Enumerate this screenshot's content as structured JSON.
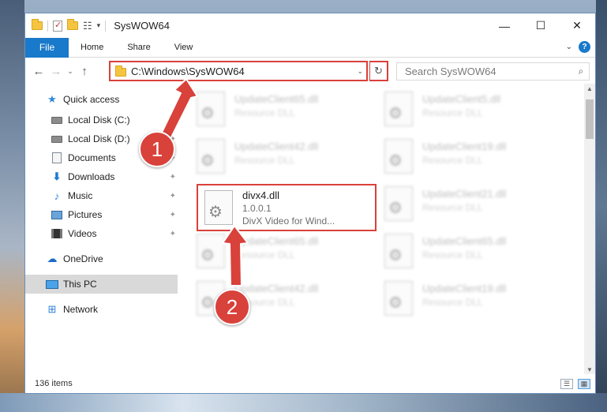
{
  "window": {
    "title": "SysWOW64",
    "controls": {
      "minimize": "—",
      "maximize": "☐",
      "close": "✕"
    }
  },
  "ribbon": {
    "file_label": "File",
    "tabs": [
      "Home",
      "Share",
      "View"
    ],
    "expand_glyph": "⌄",
    "help_glyph": "?"
  },
  "navbar": {
    "back_glyph": "←",
    "forward_glyph": "→",
    "recent_glyph": "⌄",
    "up_glyph": "↑",
    "address": "C:\\Windows\\SysWOW64",
    "address_caret": "⌄",
    "refresh_glyph": "↻",
    "search_placeholder": "Search SysWOW64",
    "search_glyph": "⌕"
  },
  "sidebar": {
    "items": [
      {
        "label": "Quick access",
        "icon": "star-icon",
        "pinned": false
      },
      {
        "label": "Local Disk (C:)",
        "icon": "drive-icon",
        "pinned": true
      },
      {
        "label": "Local Disk (D:)",
        "icon": "drive-icon",
        "pinned": true
      },
      {
        "label": "Documents",
        "icon": "documents-icon",
        "pinned": true
      },
      {
        "label": "Downloads",
        "icon": "download-icon",
        "pinned": true
      },
      {
        "label": "Music",
        "icon": "music-icon",
        "pinned": true
      },
      {
        "label": "Pictures",
        "icon": "pictures-icon",
        "pinned": true
      },
      {
        "label": "Videos",
        "icon": "videos-icon",
        "pinned": true
      },
      {
        "label": "OneDrive",
        "icon": "cloud-icon",
        "pinned": false
      },
      {
        "label": "This PC",
        "icon": "pc-icon",
        "pinned": false,
        "selected": true
      },
      {
        "label": "Network",
        "icon": "network-icon",
        "pinned": false
      }
    ],
    "pin_glyph": "📌"
  },
  "files": {
    "left_column": [
      {
        "name": "UpdateClient65.dll",
        "sub": "Resource DLL"
      },
      {
        "name": "UpdateClient42.dll",
        "sub": "Resource DLL"
      },
      {
        "name": "UpdateClient65.dll",
        "sub": "Resource DLL"
      },
      {
        "name": "UpdateClient42.dll",
        "sub": "Resource DLL"
      }
    ],
    "right_column": [
      {
        "name": "UpdateClient5.dll",
        "sub": "Resource DLL"
      },
      {
        "name": "UpdateClient19.dll",
        "sub": "Resource DLL"
      },
      {
        "name": "UpdateClient21.dll",
        "sub": "Resource DLL"
      },
      {
        "name": "UpdateClient65.dll",
        "sub": "Resource DLL"
      },
      {
        "name": "UpdateClient19.dll",
        "sub": "Resource DLL"
      }
    ],
    "highlighted": {
      "name": "divx4.dll",
      "version": "1.0.0.1",
      "description": "DivX Video for Wind..."
    }
  },
  "status": {
    "item_count": "136 items"
  },
  "annotations": {
    "step1": "1",
    "step2": "2",
    "color": "#d9413b"
  }
}
